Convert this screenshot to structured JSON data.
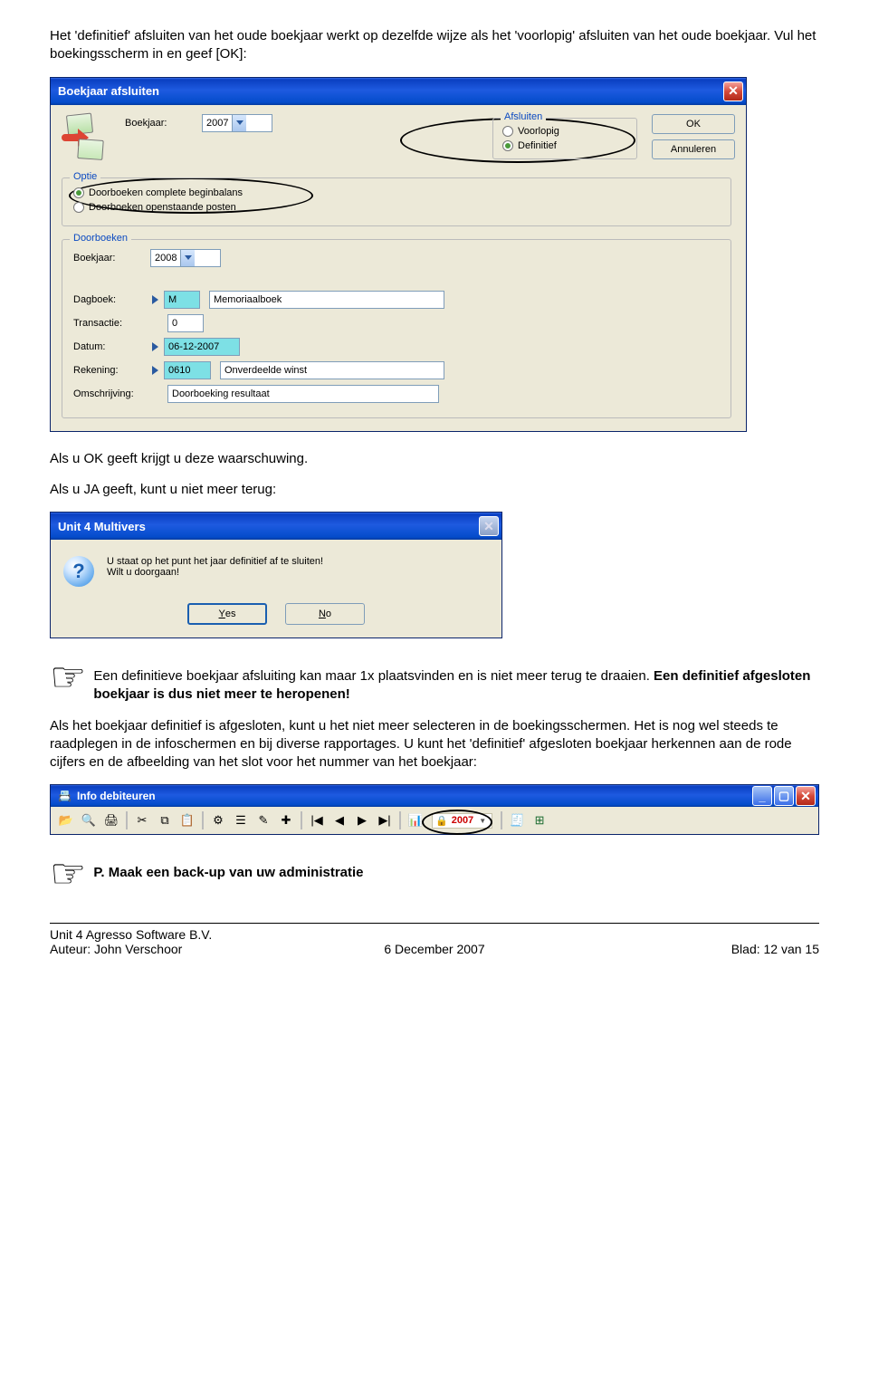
{
  "intro": {
    "p1": "Het 'definitief' afsluiten van het oude boekjaar werkt op dezelfde wijze als het 'voorlopig' afsluiten van het oude boekjaar. Vul het boekingsscherm in en geef [OK]:"
  },
  "dialog1": {
    "title": "Boekjaar afsluiten",
    "labels": {
      "boekjaar": "Boekjaar:",
      "afsluiten": "Afsluiten",
      "voorlopig": "Voorlopig",
      "definitief": "Definitief",
      "ok": "OK",
      "annuleren": "Annuleren",
      "optie": "Optie",
      "opt1": "Doorboeken complete beginbalans",
      "opt2": "Doorboeken openstaande posten",
      "doorboeken": "Doorboeken",
      "dagboek": "Dagboek:",
      "transactie": "Transactie:",
      "datum": "Datum:",
      "rekening": "Rekening:",
      "omschrijving": "Omschrijving:"
    },
    "values": {
      "boekjaar_top": "2007",
      "boekjaar_door": "2008",
      "dagboek": "M",
      "dagboek_desc": "Memoriaalboek",
      "transactie": "0",
      "datum": "06-12-2007",
      "rekening": "0610",
      "rekening_desc": "Onverdeelde winst",
      "omschrijving": "Doorboeking resultaat"
    }
  },
  "mid": {
    "p2": "Als u OK geeft krijgt u deze waarschuwing.",
    "p3": "Als u JA geeft, kunt u niet meer terug:"
  },
  "msgbox": {
    "title": "Unit 4 Multivers",
    "line1": "U staat op het punt het jaar definitief af te sluiten!",
    "line2": "Wilt u doorgaan!",
    "yes_u": "Y",
    "yes_rest": "es",
    "no_u": "N",
    "no_rest": "o"
  },
  "note": {
    "text": "Een definitieve boekjaar afsluiting kan maar 1x plaatsvinden en is niet meer terug te draaien. Een definitief afgesloten boekjaar is dus niet meer te heropenen!"
  },
  "para4": "Als het boekjaar definitief is afgesloten, kunt u het niet meer selecteren in de boekingsschermen. Het is nog wel steeds te raadplegen in de infoschermen en bij diverse rapportages. U kunt het 'definitief' afgesloten boekjaar herkennen aan de rode cijfers en de afbeelding van het slot voor het nummer van het boekjaar:",
  "toolwin": {
    "title": "Info debiteuren",
    "locked_year": "2007"
  },
  "note2": "P. Maak een back-up van uw administratie",
  "footer": {
    "l1": "Unit 4 Agresso Software B.V.",
    "l2": "Auteur: John Verschoor",
    "c": "6 December 2007",
    "r": "Blad: 12 van 15"
  }
}
